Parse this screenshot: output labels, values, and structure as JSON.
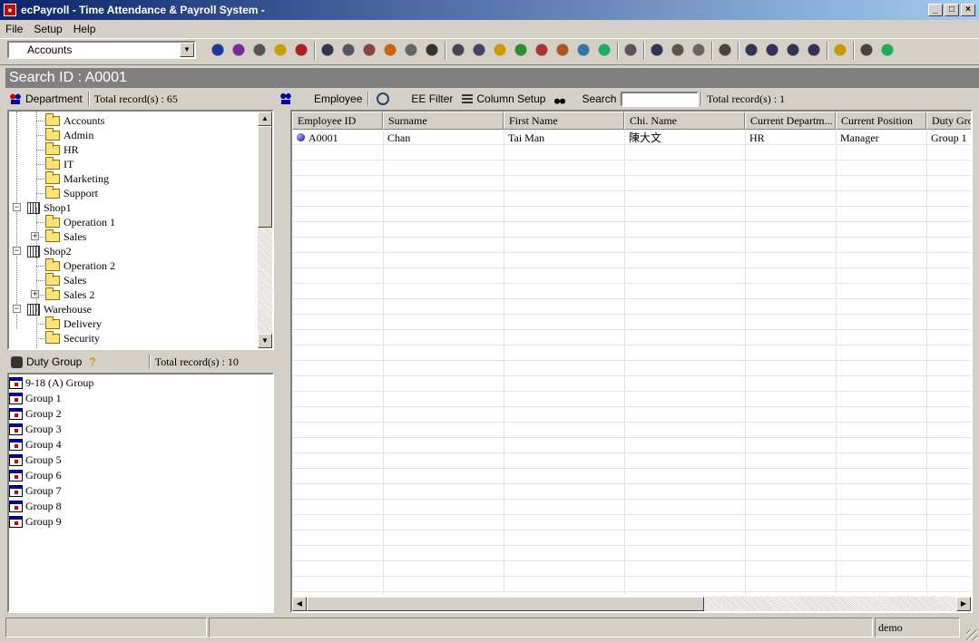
{
  "window": {
    "title": "ecPayroll - Time Attendance & Payroll System -"
  },
  "menu": [
    "File",
    "Setup",
    "Help"
  ],
  "toolbar": {
    "combo_value": "Accounts"
  },
  "search_banner": "Search ID : A0001",
  "dept_panel": {
    "label": "Department",
    "total": "Total record(s) : 65"
  },
  "tree": [
    {
      "label": "Accounts",
      "kind": "folder",
      "level": 2
    },
    {
      "label": "Admin",
      "kind": "folder",
      "level": 2
    },
    {
      "label": "HR",
      "kind": "folder",
      "level": 2
    },
    {
      "label": "IT",
      "kind": "folder",
      "level": 2
    },
    {
      "label": "Marketing",
      "kind": "folder",
      "level": 2
    },
    {
      "label": "Support",
      "kind": "folder",
      "level": 2
    },
    {
      "label": "Shop1",
      "kind": "building",
      "level": 1
    },
    {
      "label": "Operation 1",
      "kind": "folder",
      "level": 2
    },
    {
      "label": "Sales",
      "kind": "folder",
      "level": 2,
      "expand": true
    },
    {
      "label": "Shop2",
      "kind": "building",
      "level": 1
    },
    {
      "label": "Operation 2",
      "kind": "folder",
      "level": 2
    },
    {
      "label": "Sales",
      "kind": "folder",
      "level": 2
    },
    {
      "label": "Sales 2",
      "kind": "folder",
      "level": 2,
      "expand": true
    },
    {
      "label": "Warehouse",
      "kind": "building",
      "level": 1
    },
    {
      "label": "Delivery",
      "kind": "folder",
      "level": 2
    },
    {
      "label": "Security",
      "kind": "folder",
      "level": 2
    }
  ],
  "duty_panel": {
    "label": "Duty Group",
    "total": "Total record(s) : 10"
  },
  "duty_groups": [
    "9-18 (A) Group",
    "Group 1",
    "Group 2",
    "Group 3",
    "Group 4",
    "Group 5",
    "Group 6",
    "Group 7",
    "Group 8",
    "Group 9"
  ],
  "emp_toolbar": {
    "employee": "Employee",
    "ee_filter": "EE Filter",
    "column_setup": "Column Setup",
    "search_id_label": "Search ID",
    "search_id_value": "",
    "total": "Total record(s) : 1"
  },
  "grid": {
    "columns": [
      "Employee ID",
      "Surname",
      "First Name",
      "Chi. Name",
      "Current Departm...",
      "Current Position",
      "Duty Gro"
    ],
    "rows": [
      [
        "A0001",
        "Chan",
        "Tai Man",
        "陳大文",
        "HR",
        "Manager",
        "Group 1"
      ]
    ]
  },
  "status": {
    "user": "demo"
  }
}
